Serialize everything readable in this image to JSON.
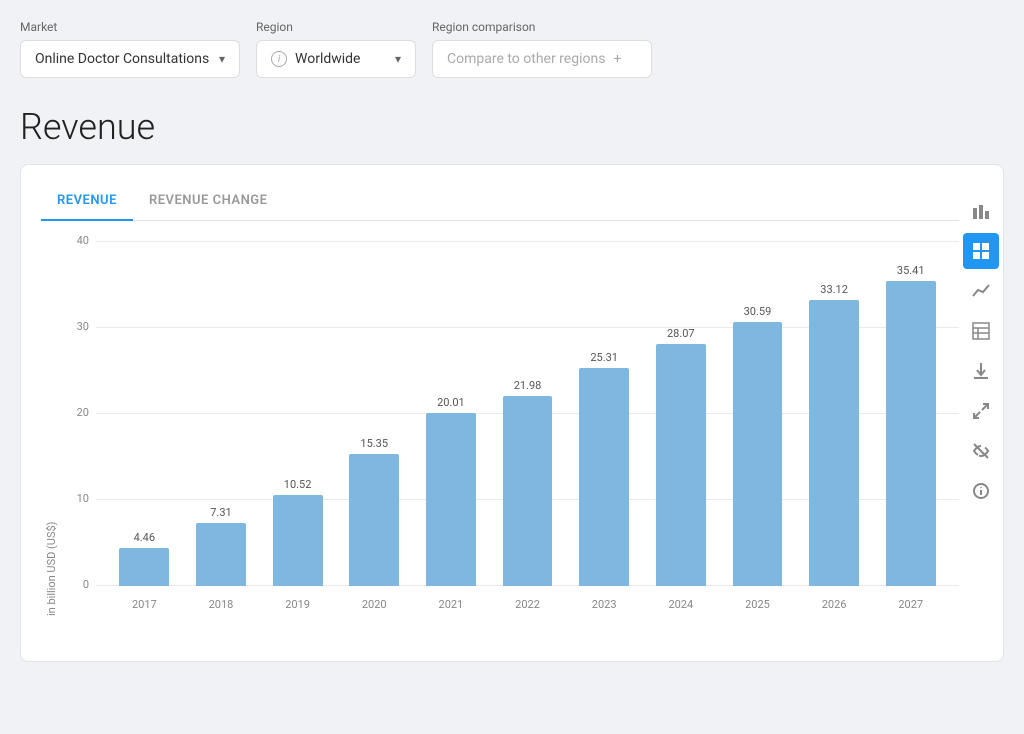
{
  "filters": {
    "market": {
      "label": "Market",
      "selected": "Online Doctor Consultations",
      "chevron": "▾"
    },
    "region": {
      "label": "Region",
      "selected": "Worldwide",
      "chevron": "▾"
    },
    "comparison": {
      "label": "Region comparison",
      "placeholder": "Compare to other regions",
      "plus": "+"
    }
  },
  "section_title": "Revenue",
  "chart": {
    "tab_active": "REVENUE",
    "tab_inactive": "REVENUE CHANGE",
    "y_axis_label": "in billion USD (US$)",
    "y_axis_ticks": [
      "40",
      "30",
      "20",
      "10",
      "0"
    ],
    "bars": [
      {
        "year": "2017",
        "value": 4.46,
        "label": "4.46"
      },
      {
        "year": "2018",
        "value": 7.31,
        "label": "7.31"
      },
      {
        "year": "2019",
        "value": 10.52,
        "label": "10.52"
      },
      {
        "year": "2020",
        "value": 15.35,
        "label": "15.35"
      },
      {
        "year": "2021",
        "value": 20.01,
        "label": "20.01"
      },
      {
        "year": "2022",
        "value": 21.98,
        "label": "21.98"
      },
      {
        "year": "2023",
        "value": 25.31,
        "label": "25.31"
      },
      {
        "year": "2024",
        "value": 28.07,
        "label": "28.07"
      },
      {
        "year": "2025",
        "value": 30.59,
        "label": "30.59"
      },
      {
        "year": "2026",
        "value": 33.12,
        "label": "33.12"
      },
      {
        "year": "2027",
        "value": 35.41,
        "label": "35.41"
      }
    ],
    "max_value": 40,
    "sidebar_icons": [
      {
        "name": "bar-chart-icon",
        "symbol": "▐▌",
        "active": false
      },
      {
        "name": "grid-chart-icon",
        "symbol": "▦",
        "active": true
      },
      {
        "name": "line-chart-icon",
        "symbol": "∿",
        "active": false
      },
      {
        "name": "table-icon",
        "symbol": "⊞",
        "active": false
      },
      {
        "name": "download-icon",
        "symbol": "↓",
        "active": false
      },
      {
        "name": "expand-icon",
        "symbol": "⤢",
        "active": false
      },
      {
        "name": "hide-icon",
        "symbol": "⊘",
        "active": false
      },
      {
        "name": "info-icon",
        "symbol": "ℹ",
        "active": false
      }
    ]
  }
}
